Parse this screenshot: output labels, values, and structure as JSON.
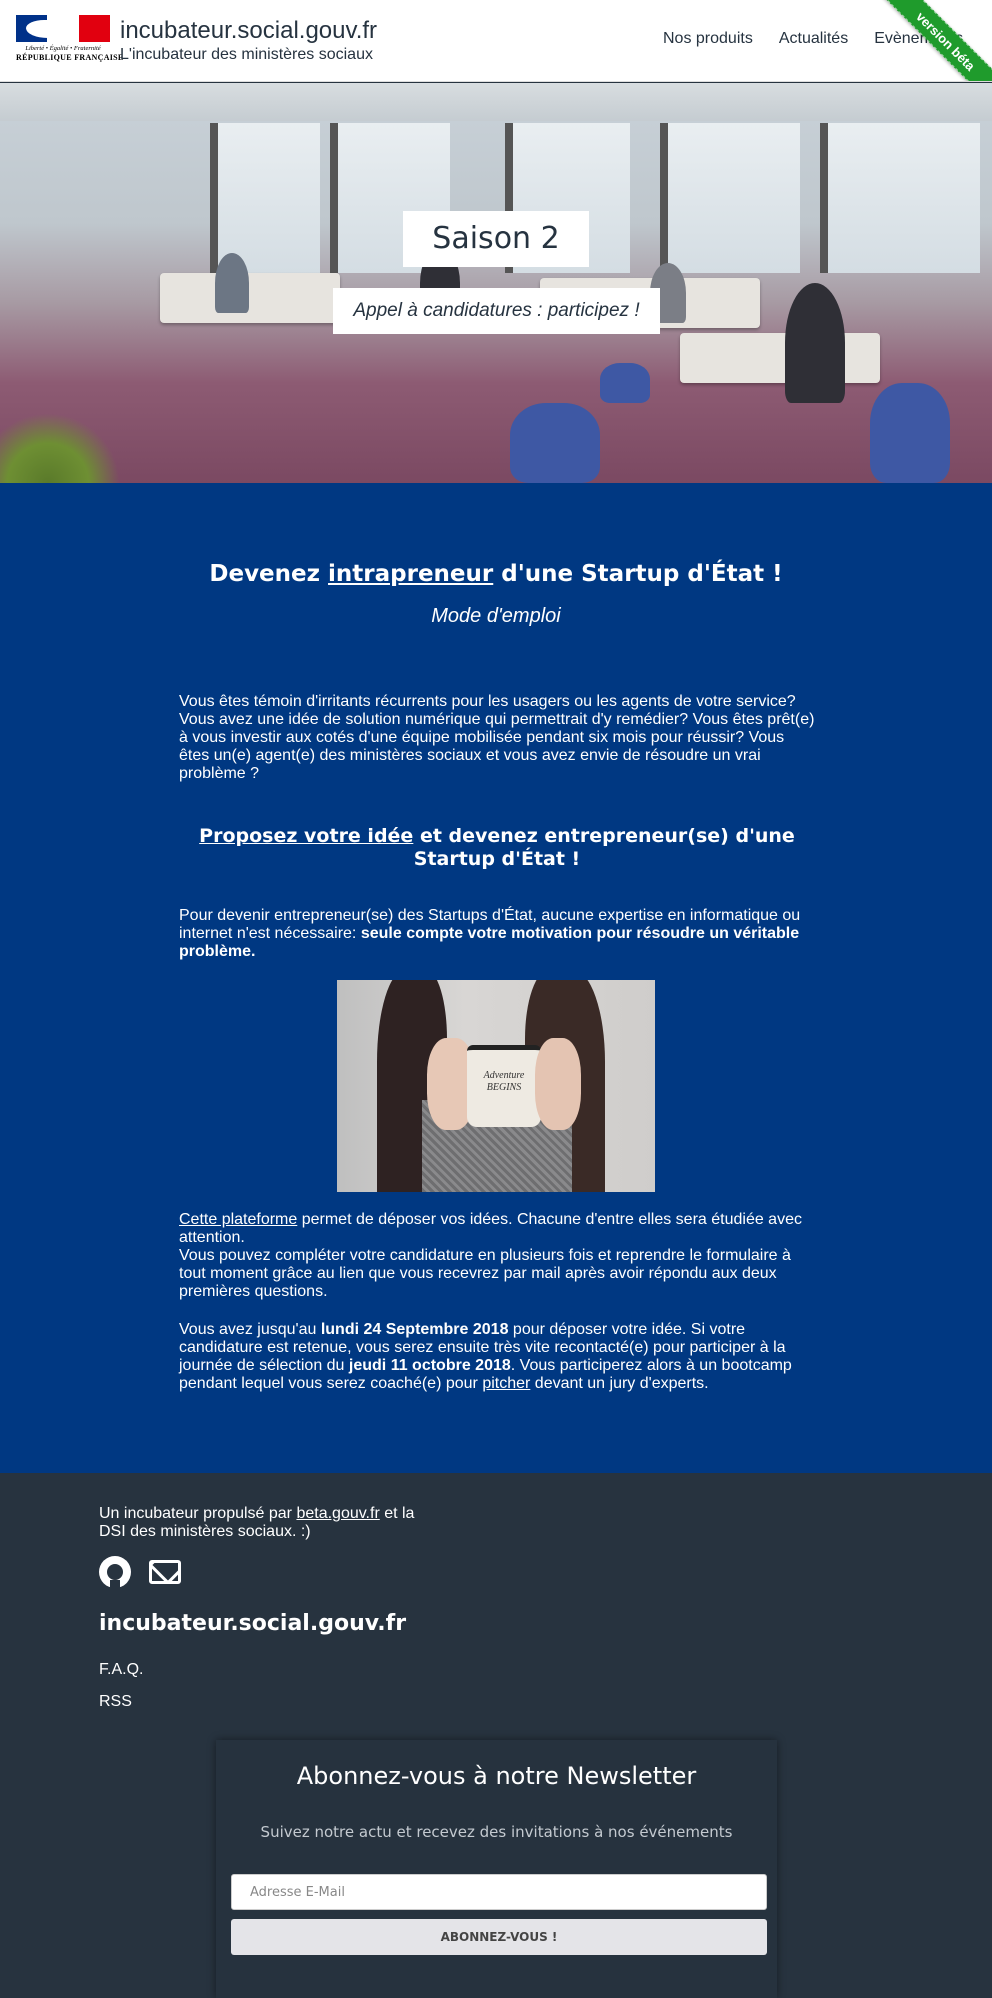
{
  "header": {
    "logo": {
      "motto": "Liberté • Égalité • Fraternité",
      "republic": "RÉPUBLIQUE FRANÇAISE",
      "flag_colors": [
        "#003189",
        "#ffffff",
        "#e1000f"
      ]
    },
    "site_title": "incubateur.social.gouv.fr",
    "site_subtitle": "L'incubateur des ministères sociaux",
    "nav": [
      "Nos produits",
      "Actualités",
      "Evènements"
    ],
    "ribbon": "version béta"
  },
  "hero": {
    "season": "Saison 2",
    "call": "Appel à candidatures : participez !"
  },
  "main": {
    "title_pre": "Devenez ",
    "title_link": "intrapreneur",
    "title_post": " d'une Startup d'État !",
    "mode": "Mode d'emploi",
    "intro": "Vous êtes témoin d'irritants récurrents pour les usagers ou les agents de votre service? Vous avez une idée de solution numérique qui permettrait d'y remédier? Vous êtes prêt(e) à vous investir aux cotés d'une équipe mobilisée pendant six mois pour réussir? Vous êtes un(e) agent(e) des ministères sociaux et vous avez envie de résoudre un vrai problème ?",
    "h2_link": "Proposez votre idée",
    "h2_post": " et devenez entrepreneur(se) d'une Startup d'État !",
    "p2_pre": "Pour devenir entrepreneur(se) des Startups d'État, aucune expertise en informatique ou internet n'est nécessaire: ",
    "p2_bold": "seule compte votre motivation pour résoudre un véritable problème.",
    "photo": {
      "mug_line1": "Adventure",
      "mug_line2": "BEGINS"
    },
    "p3_link": "Cette plateforme",
    "p3_text": " permet de déposer vos idées. Chacune d'entre elles sera étudiée avec attention.",
    "p3_text2": "Vous pouvez compléter votre candidature en plusieurs fois et reprendre le formulaire à tout moment grâce au lien que vous recevrez par mail après avoir répondu aux deux premières questions.",
    "p4_a": "Vous avez jusqu'au ",
    "p4_b": "lundi 24 Septembre 2018",
    "p4_c": " pour déposer votre idée. Si votre candidature est retenue, vous serez ensuite très vite recontacté(e) pour participer à la journée de sélection du ",
    "p4_d": "jeudi 11 octobre 2018",
    "p4_e": ". Vous participerez alors à un bootcamp pendant lequel vous serez coaché(e) pour ",
    "p4_link": "pitcher",
    "p4_f": " devant un jury d'experts."
  },
  "footer": {
    "propulse_pre": "Un incubateur propulsé par ",
    "propulse_link": "beta.gouv.fr",
    "propulse_post": " et la DSI des ministères sociaux. :)",
    "social": [
      "github-icon",
      "mail-icon"
    ],
    "title": "incubateur.social.gouv.fr",
    "faq": "F.A.Q.",
    "rss": "RSS",
    "newsletter": {
      "title": "Abonnez-vous à notre Newsletter",
      "subtitle": "Suivez notre actu et recevez des invitations à nos événements",
      "placeholder": "Adresse E-Mail",
      "button": "ABONNEZ-VOUS !"
    }
  }
}
